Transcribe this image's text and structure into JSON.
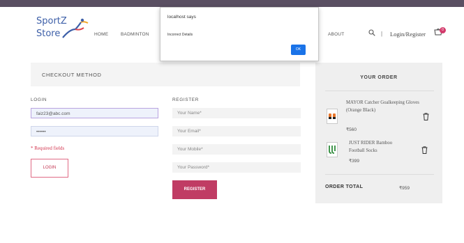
{
  "header": {
    "logo_line1": "SportZ",
    "logo_line2": "Store",
    "nav": {
      "home": "HOME",
      "badminton": "BADMINTON",
      "about": "ABOUT"
    },
    "login_register": "Login/Register",
    "separator": "|",
    "cart_count": "0"
  },
  "checkout": {
    "title": "CHECKOUT METHOD",
    "login": {
      "label": "LOGIN",
      "email_value": "faiz23@abc.com",
      "password_value": "••••••",
      "required_text": "* Required fields",
      "button": "LOGIN"
    },
    "register": {
      "label": "REGISTER",
      "name_placeholder": "Your Name*",
      "email_placeholder": "Your Email*",
      "mobile_placeholder": "Your Mobile*",
      "password_placeholder": "Your Password*",
      "button": "REGISTER"
    }
  },
  "order": {
    "title": "YOUR ORDER",
    "items": [
      {
        "name": "MAYOR Catcher Goalkeeping Gloves (Orange Black)",
        "price": "₹560"
      },
      {
        "name": "JUST RIDER Bamboo Football Socks",
        "price": "₹399"
      }
    ],
    "total_label": "ORDER TOTAL",
    "total_value": "₹959"
  },
  "alert": {
    "title": "localhost says",
    "message": "Incorrect Details",
    "ok": "OK"
  },
  "colors": {
    "accent": "#c03c64",
    "topbar": "#5a4f62",
    "alert_button": "#1a73e8"
  }
}
